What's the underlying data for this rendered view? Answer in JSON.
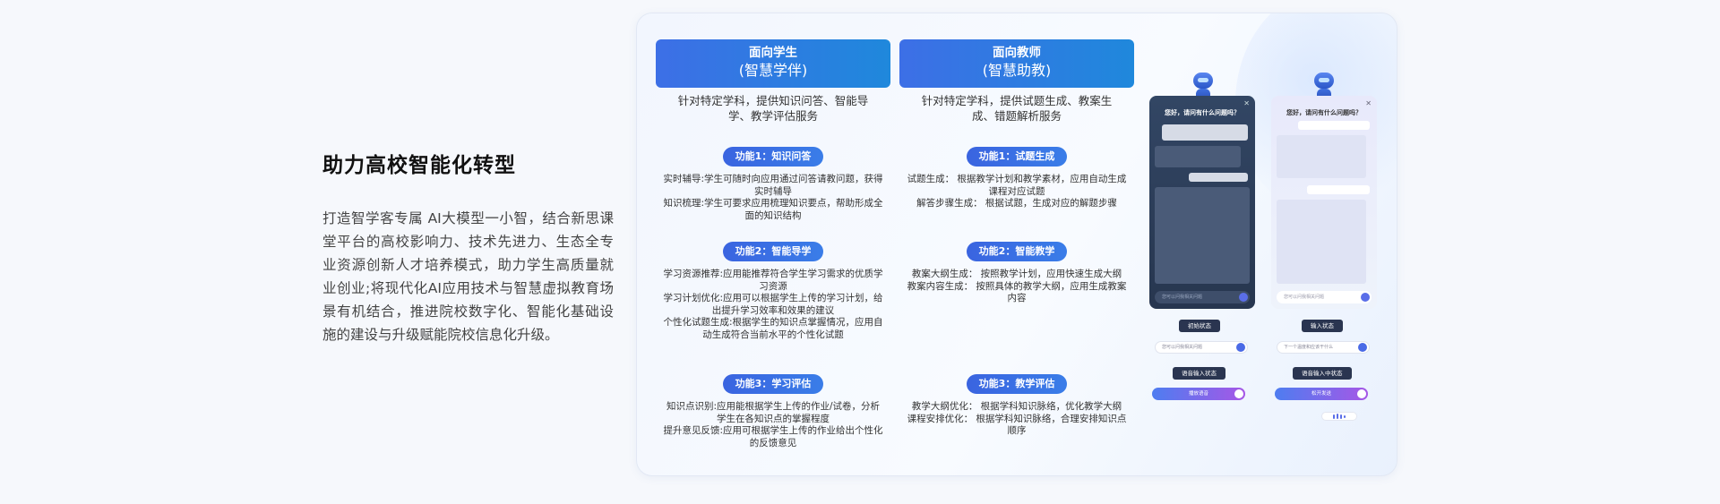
{
  "intro": {
    "title": "助力高校智能化转型",
    "body": "打造智学客专属 AI大模型一小智，结合新思课堂平台的高校影响力、技术先进力、生态全专业资源创新人才培养模式，助力学生高质量就业创业;将现代化AI应用技术与智慧虚拟教育场景有机结合，推进院校数字化、智能化基础设施的建设与升级赋能院校信息化升级。"
  },
  "students": {
    "title": "面向学生",
    "subtitle": "(智慧学伴)",
    "desc": "针对特定学科，提供知识问答、智能导学、教学评估服务",
    "features": [
      {
        "label": "功能1：知识问答",
        "lines": [
          "实时辅导:学生可随时向应用通过问答请教问题，获得实时辅导",
          "知识梳理:学生可要求应用梳理知识要点，帮助形成全面的知识结构"
        ]
      },
      {
        "label": "功能2：智能导学",
        "lines": [
          "学习资源推荐:应用能推荐符合学生学习需求的优质学习资源",
          "学习计划优化:应用可以根据学生上传的学习计划，给出提升学习效率和效果的建议",
          "个性化试题生成:根据学生的知识点掌握情况，应用自动生成符合当前水平的个性化试题"
        ]
      },
      {
        "label": "功能3：学习评估",
        "lines": [
          "知识点识别:应用能根据学生上传的作业/试卷，分析学生在各知识点的掌握程度",
          "提升意见反馈:应用可根据学生上传的作业给出个性化的反馈意见"
        ]
      }
    ]
  },
  "teachers": {
    "title": "面向教师",
    "subtitle": "(智慧助教)",
    "desc": "针对特定学科，提供试题生成、教案生成、错题解析服务",
    "features": [
      {
        "label": "功能1：试题生成",
        "lines": [
          "试题生成：  根据教学计划和教学素材，应用自动生成课程对应试题",
          "解答步骤生成：  根据试题，生成对应的解题步骤"
        ]
      },
      {
        "label": "功能2：智能教学",
        "lines": [
          "教案大纲生成：  按照教学计划，应用快速生成大纲",
          "教案内容生成：  按照具体的教学大纲，应用生成教案内容"
        ]
      },
      {
        "label": "功能3：教学评估",
        "lines": [
          "教学大纲优化：  根据学科知识脉络，优化教学大纲",
          "课程安排优化：  根据学科知识脉络，合理安排知识点顺序"
        ]
      }
    ]
  },
  "phones": {
    "greeting": "您好，请问有什么问题吗？",
    "dark_input_placeholder": "您可以问我相关问题",
    "light_input_placeholder": "您可以问我相关问题"
  },
  "states": {
    "init_label": "初始状态",
    "input_label": "输入状态",
    "left_input_placeholder": "您可以问我相关问题",
    "right_input_text": "下一个温度和应该干什么",
    "voice_label_left": "语音输入状态",
    "voice_label_right": "语音输入中状态",
    "voice_bar_left": "播放语音",
    "voice_bar_right": "松开发送"
  }
}
